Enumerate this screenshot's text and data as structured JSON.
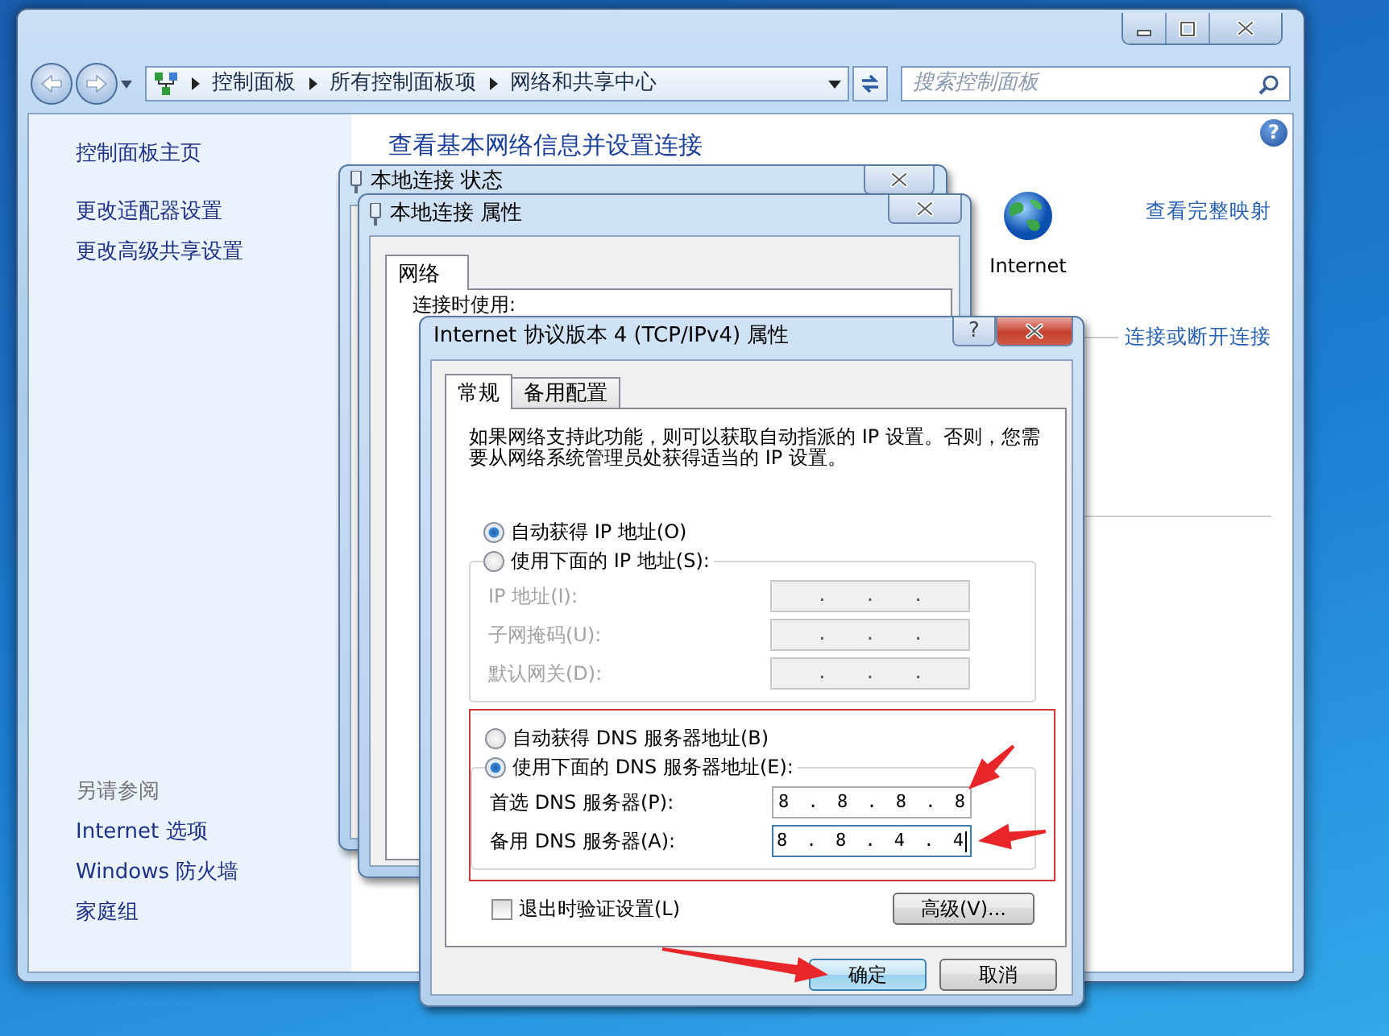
{
  "explorer": {
    "breadcrumb": [
      "控制面板",
      "所有控制面板项",
      "网络和共享中心"
    ],
    "search": {
      "placeholder": "搜索控制面板"
    },
    "help": "?",
    "sidebar": {
      "items": [
        {
          "label": "控制面板主页"
        },
        {
          "label": "更改适配器设置"
        },
        {
          "label": "更改高级共享设置"
        }
      ],
      "see_also_title": "另请参阅",
      "see_also": [
        {
          "label": "Internet 选项"
        },
        {
          "label": "Windows 防火墙"
        },
        {
          "label": "家庭组"
        }
      ]
    },
    "heading": "查看基本网络信息并设置连接",
    "network_map": {
      "node_label": "Internet",
      "full_map_link": "查看完整映射",
      "connect_link": "连接或断开连接"
    }
  },
  "status_window": {
    "title": "本地连接 状态"
  },
  "properties_window": {
    "title": "本地连接 属性",
    "tabs": [
      {
        "label": "网络",
        "selected": true
      }
    ],
    "connect_using_label": "连接时使用:"
  },
  "ipv4_dialog": {
    "title": "Internet 协议版本 4 (TCP/IPv4) 属性",
    "help": "?",
    "tabs": [
      {
        "label": "常规",
        "selected": true
      },
      {
        "label": "备用配置",
        "selected": false
      }
    ],
    "intro": "如果网络支持此功能，则可以获取自动指派的 IP 设置。否则，您需要从网络系统管理员处获得适当的 IP 设置。",
    "ip_mode": [
      {
        "label": "自动获得 IP 地址(O)",
        "selected": true
      },
      {
        "label": "使用下面的 IP 地址(S):",
        "selected": false
      }
    ],
    "ip_fields": [
      {
        "label": "IP 地址(I):",
        "value": ".  .  .",
        "disabled": true
      },
      {
        "label": "子网掩码(U):",
        "value": ".  .  .",
        "disabled": true
      },
      {
        "label": "默认网关(D):",
        "value": ".  .  .",
        "disabled": true
      }
    ],
    "dns_highlighted": true,
    "dns_mode": [
      {
        "label": "自动获得 DNS 服务器地址(B)",
        "selected": false
      },
      {
        "label": "使用下面的 DNS 服务器地址(E):",
        "selected": true
      }
    ],
    "dns_fields": [
      {
        "label": "首选 DNS 服务器(P):",
        "value": "8 . 8 . 8 . 8",
        "disabled": false,
        "focused": false
      },
      {
        "label": "备用 DNS 服务器(A):",
        "value": "8 . 8 . 4 . 4",
        "disabled": false,
        "focused": true
      }
    ],
    "validate": {
      "label": "退出时验证设置(L)",
      "checked": false
    },
    "advanced_button": "高级(V)...",
    "buttons": [
      {
        "label": "确定",
        "default": true
      },
      {
        "label": "取消",
        "default": false
      }
    ]
  }
}
